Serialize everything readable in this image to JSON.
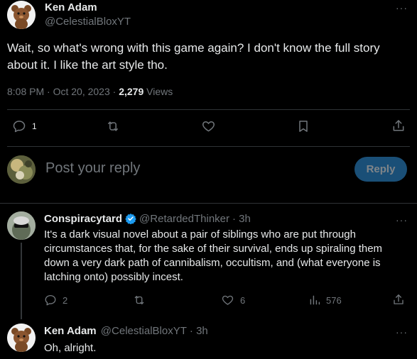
{
  "main_tweet": {
    "author_name": "Ken Adam",
    "author_handle": "@CelestialBloxYT",
    "text": "Wait, so what's wrong with this game again? I don't know the full story about it. I like the art style tho.",
    "time": "8:08 PM",
    "sep1": " · ",
    "date": "Oct 20, 2023",
    "sep2": " · ",
    "views_count": "2,279",
    "views_label": " Views",
    "reply_count": "1"
  },
  "compose": {
    "placeholder": "Post your reply",
    "reply_button": "Reply"
  },
  "replies": [
    {
      "author_name": "Conspiracytard",
      "author_handle": "@RetardedThinker",
      "time": "· 3h",
      "text": "It's a dark visual novel about a pair of siblings who are put through circumstances that, for the sake of their survival, ends up spiraling them down a very dark path of cannibalism, occultism, and (what everyone is latching onto) possibly incest.",
      "reply_count": "2",
      "like_count": "6",
      "view_count": "576"
    },
    {
      "author_name": "Ken Adam",
      "author_handle": "@CelestialBloxYT",
      "time": "· 3h",
      "text": "Oh, alright."
    }
  ],
  "colors": {
    "accent": "#1d9bf0",
    "reply_button_bg": "#1a4f77",
    "muted": "#71767b",
    "divider": "#2f3336"
  },
  "icons": {
    "more": "more-icon",
    "reply": "reply-icon",
    "retweet": "retweet-icon",
    "like": "heart-icon",
    "bookmark": "bookmark-icon",
    "share": "share-icon",
    "views": "views-icon",
    "verified": "verified-badge-icon"
  }
}
